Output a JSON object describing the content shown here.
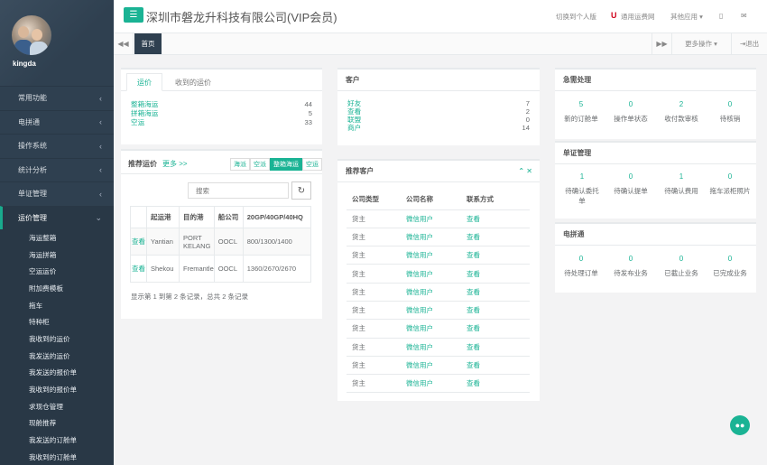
{
  "sidebar": {
    "username": "kingda",
    "menu": [
      {
        "label": "常用功能"
      },
      {
        "label": "电拼通"
      },
      {
        "label": "操作系统"
      },
      {
        "label": "统计分析"
      },
      {
        "label": "单证管理"
      },
      {
        "label": "运价管理"
      }
    ],
    "submenu": [
      "海运整箱",
      "海运拼箱",
      "空运运价",
      "附加费模板",
      "拖车",
      "特种柜",
      "我收到的运价",
      "我发送的运价",
      "我发送的报价单",
      "我收到的报价单",
      "求现仓管理",
      "现舱推荐",
      "我发送的订舱单",
      "我收到的订舱单"
    ]
  },
  "header": {
    "company": "深圳市磐龙升科技有限公司(VIP会员)",
    "switch_personal": "切换到个人版",
    "universal": "通用运费网",
    "other_apps": "其他应用 ▾"
  },
  "tabbar": {
    "home": "首页",
    "more_ops": "更多操作 ▾",
    "exit": "退出"
  },
  "freight": {
    "tabs": [
      "运价",
      "收到的运价"
    ],
    "rows": [
      {
        "label": "整箱海运",
        "count": "44"
      },
      {
        "label": "拼箱海运",
        "count": "5"
      },
      {
        "label": "空运",
        "count": "33"
      }
    ]
  },
  "customers": {
    "title": "客户",
    "rows": [
      {
        "label": "好友",
        "count": "7"
      },
      {
        "label": "查看",
        "count": "2"
      },
      {
        "label": "联盟",
        "count": "0"
      },
      {
        "label": "商户",
        "count": "14"
      }
    ]
  },
  "recommend_rates": {
    "title": "推荐运价",
    "more": "更多 >>",
    "filters": [
      "海派",
      "空派",
      "整箱海运",
      "空运"
    ],
    "search_placeholder": "搜索",
    "headers": [
      "",
      "起运港",
      "目的港",
      "船公司",
      "20GP/40GP/40HQ"
    ],
    "rows": [
      {
        "action": "查看",
        "origin": "Yantian",
        "dest": "PORT KELANG",
        "carrier": "OOCL",
        "price": "800/1300/1400"
      },
      {
        "action": "查看",
        "origin": "Shekou",
        "dest": "Fremantle",
        "carrier": "OOCL",
        "price": "1360/2670/2670"
      }
    ],
    "footer": "显示第 1 到第 2 条记录，总共 2 条记录"
  },
  "recommend_customers": {
    "title": "推荐客户",
    "headers": [
      "公司类型",
      "公司名称",
      "联系方式"
    ],
    "rows": [
      {
        "type": "货主",
        "name": "微信用户",
        "contact": "查看"
      },
      {
        "type": "货主",
        "name": "微信用户",
        "contact": "查看"
      },
      {
        "type": "货主",
        "name": "微信用户",
        "contact": "查看"
      },
      {
        "type": "货主",
        "name": "微信用户",
        "contact": "查看"
      },
      {
        "type": "货主",
        "name": "微信用户",
        "contact": "查看"
      },
      {
        "type": "货主",
        "name": "微信用户",
        "contact": "查看"
      },
      {
        "type": "货主",
        "name": "微信用户",
        "contact": "查看"
      },
      {
        "type": "货主",
        "name": "微信用户",
        "contact": "查看"
      },
      {
        "type": "货主",
        "name": "微信用户",
        "contact": "查看"
      },
      {
        "type": "货主",
        "name": "微信用户",
        "contact": "查看"
      }
    ]
  },
  "urgent": {
    "title": "急需处理",
    "items": [
      {
        "n": "5",
        "label": "新的订舱单"
      },
      {
        "n": "0",
        "label": "操作单状态"
      },
      {
        "n": "2",
        "label": "收付款审核"
      },
      {
        "n": "0",
        "label": "待核销"
      }
    ]
  },
  "documents": {
    "title": "单证管理",
    "items": [
      {
        "n": "1",
        "label": "待确认委托单"
      },
      {
        "n": "0",
        "label": "待确认提单"
      },
      {
        "n": "1",
        "label": "待确认费用"
      },
      {
        "n": "0",
        "label": "拖车派柜照片"
      }
    ]
  },
  "dianpin": {
    "title": "电拼通",
    "items": [
      {
        "n": "0",
        "label": "待处理订单"
      },
      {
        "n": "0",
        "label": "待发布业务"
      },
      {
        "n": "0",
        "label": "已截止业务"
      },
      {
        "n": "0",
        "label": "已完成业务"
      }
    ]
  }
}
